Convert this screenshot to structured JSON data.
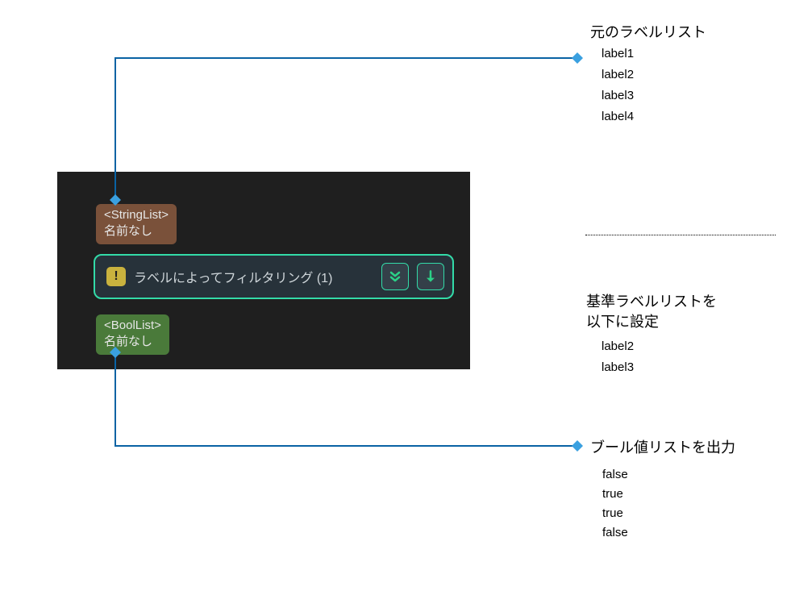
{
  "panel": {
    "stringlist": {
      "type": "<StringList>",
      "name": "名前なし"
    },
    "boollist": {
      "type": "<BoolList>",
      "name": "名前なし"
    },
    "filter": {
      "label": "ラベルによってフィルタリング (1)"
    }
  },
  "anno": {
    "source": {
      "title": "元のラベルリスト",
      "items": [
        "label1",
        "label2",
        "label3",
        "label4"
      ]
    },
    "criteria": {
      "title": "基準ラベルリストを\n以下に設定",
      "items": [
        "label2",
        "label3"
      ]
    },
    "output": {
      "title": "ブール値リストを出力",
      "items": [
        "false",
        "true",
        "true",
        "false"
      ]
    }
  },
  "icons": {
    "warn": "!",
    "doubleDown": "double-down-arrow",
    "down": "down-arrow"
  },
  "colors": {
    "panelBg": "#1f1f1f",
    "stringlistBg": "#7a513a",
    "boollistBg": "#4a7a3a",
    "nodeBg": "#27323a",
    "accent": "#33dba8",
    "arrowGreen": "#2bd187",
    "connectorBlue": "#0a63a4",
    "diamondBlue": "#3aa0e0",
    "warnBg": "#c9b23e"
  }
}
